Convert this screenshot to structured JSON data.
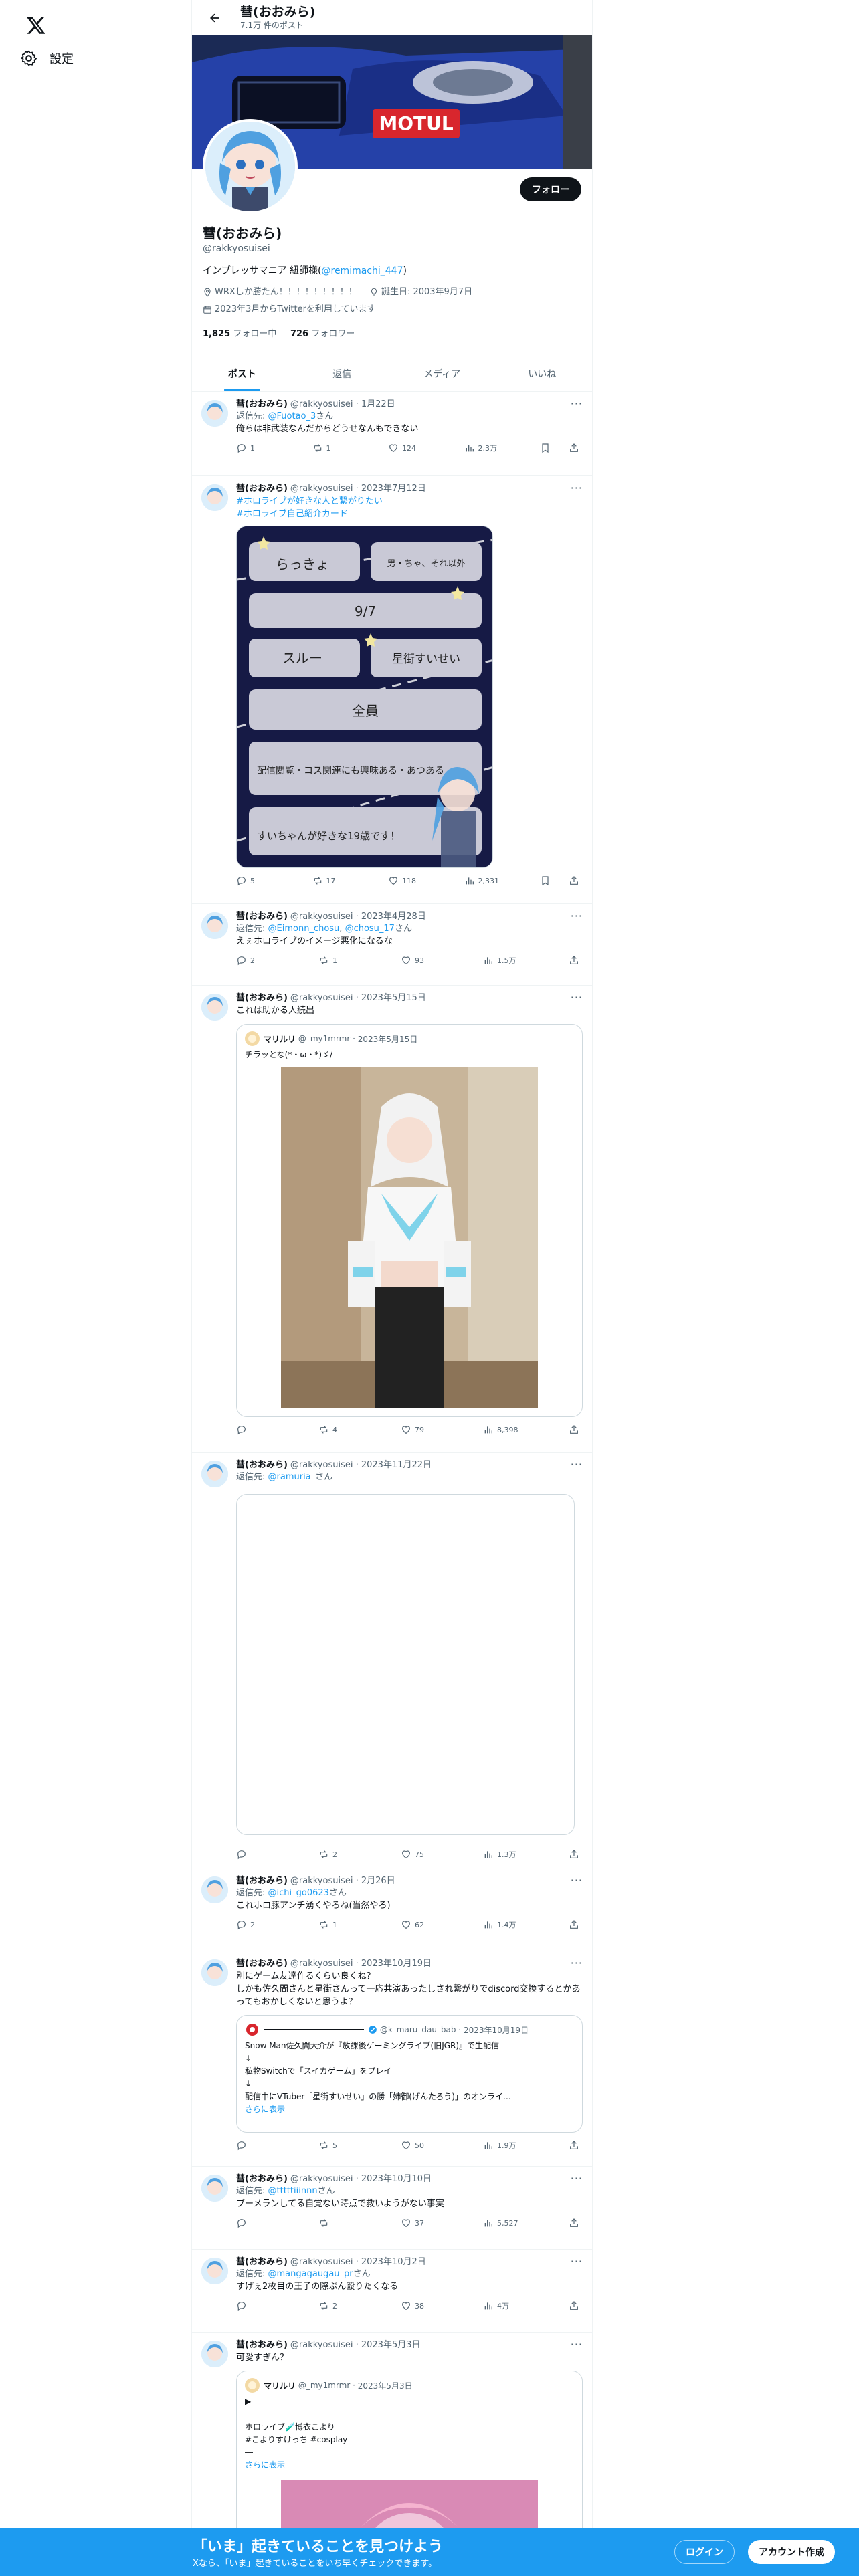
{
  "nav": {
    "settings_label": "設定"
  },
  "header": {
    "name": "彗(おおみら)",
    "post_count": "7.1万 件のポスト"
  },
  "banner": {
    "brand_text": "MOTUL"
  },
  "profile": {
    "follow_label": "フォロー",
    "name": "彗(おおみら)",
    "handle": "@rakkyosuisei",
    "bio_text": "インプレッサマニア 紐師様(",
    "bio_link": "@remimachi_447",
    "bio_end": ")",
    "location": "WRXしか勝たん！！！！！！！！！",
    "birthday": "誕生日: 2003年9月7日",
    "joined": "2023年3月からTwitterを利用しています",
    "following_count": "1,825",
    "following_label": "フォロー中",
    "followers_count": "726",
    "followers_label": "フォロワー"
  },
  "tabs": [
    "ポスト",
    "返信",
    "メディア",
    "いいね"
  ],
  "tweets": [
    {
      "name": "彗(おおみら)",
      "handle": "@rakkyosuisei",
      "date": "1月22日",
      "reply_prefix": "返信先: ",
      "reply_to": "@Fuotao_3",
      "reply_suffix": "さん",
      "text": "俺らは非武装なんだからどうせなんもできない",
      "replies": "1",
      "reposts": "1",
      "likes": "124",
      "views": "2.3万"
    },
    {
      "name": "彗(おおみら)",
      "handle": "@rakkyosuisei",
      "date": "2023年7月12日",
      "hashtag1": "#ホロライブが好きな人と繋がりたい",
      "hashtag2": "#ホロライブ自己紹介カード",
      "replies": "5",
      "reposts": "17",
      "likes": "118",
      "views": "2,331",
      "card": {
        "field1": "らっきょ",
        "field2": "男・ちゃ、それ以外",
        "field3": "9/7",
        "field4": "スルー",
        "field5": "星街すいせい",
        "field6": "全員",
        "field7": "配信閲覧・コス関連にも興味ある・あつある",
        "field8": "すいちゃんが好きな19歳です！"
      }
    },
    {
      "name": "彗(おおみら)",
      "handle": "@rakkyosuisei",
      "date": "2023年4月28日",
      "reply_prefix": "返信先: ",
      "reply_to": "@Eimonn_chosu",
      "reply_to2": "@chosu_17",
      "reply_suffix": "さん",
      "text": "えぇホロライブのイメージ悪化になるな",
      "replies": "2",
      "reposts": "1",
      "likes": "93",
      "views": "1.5万"
    },
    {
      "name": "彗(おおみら)",
      "handle": "@rakkyosuisei",
      "date": "2023年5月15日",
      "text": "これは助かる人続出",
      "quote": {
        "name": "マリルリ",
        "handle": "@_my1mrmr",
        "date": "2023年5月15日",
        "text": "チラッとな(*・ω・*)ゞ/"
      },
      "replies": "",
      "reposts": "4",
      "likes": "79",
      "views": "8,398"
    },
    {
      "name": "彗(おおみら)",
      "handle": "@rakkyosuisei",
      "date": "2023年11月22日",
      "reply_prefix": "返信先: ",
      "reply_to": "@ramuria_",
      "reply_suffix": "さん",
      "replies": "",
      "reposts": "2",
      "likes": "75",
      "views": "1.3万"
    },
    {
      "name": "彗(おおみら)",
      "handle": "@rakkyosuisei",
      "date": "2月26日",
      "reply_prefix": "返信先: ",
      "reply_to": "@ichi_go0623",
      "reply_suffix": "さん",
      "text": "これホロ豚アンチ湧くやろね(当然やろ)",
      "replies": "2",
      "reposts": "1",
      "likes": "62",
      "views": "1.4万"
    },
    {
      "name": "彗(おおみら)",
      "handle": "@rakkyosuisei",
      "date": "2023年10月19日",
      "text": "別にゲーム友達作るくらい良くね？\nしかも佐久間さんと星街さんって一応共演あったしされ繋がりでdiscord交換するとかあってもおかしくないと思うよ？",
      "quote": {
        "name": "",
        "handle": "@k_maru_dau_bab",
        "date": "2023年10月19日",
        "text": "Snow Man佐久間大介が『放課後ゲーミングライブ(旧JGR)』で生配信\n↓\n私物Switchで「スイカゲーム」をプレイ\n↓\n配信中にVTuber「星街すいせい」の勝「姉御(げんたろう)」のオンライ…",
        "more": "さらに表示"
      },
      "replies": "",
      "reposts": "5",
      "likes": "50",
      "views": "1.9万"
    },
    {
      "name": "彗(おおみら)",
      "handle": "@rakkyosuisei",
      "date": "2023年10月10日",
      "reply_prefix": "返信先: ",
      "reply_to": "@tttttiiinnn",
      "reply_suffix": "さん",
      "text": "ブーメランしてる自覚ない時点で救いようがない事実",
      "replies": "",
      "reposts": "",
      "likes": "37",
      "views": "5,527"
    },
    {
      "name": "彗(おおみら)",
      "handle": "@rakkyosuisei",
      "date": "2023年10月2日",
      "reply_prefix": "返信先: ",
      "reply_to": "@mangagaugau_pr",
      "reply_suffix": "さん",
      "text": "すげぇ2枚目の王子の際ぷん殴りたくなる",
      "replies": "",
      "reposts": "2",
      "likes": "38",
      "views": "4万"
    },
    {
      "name": "彗(おおみら)",
      "handle": "@rakkyosuisei",
      "date": "2023年5月3日",
      "text": "可愛すぎん？",
      "quote": {
        "name": "マリルリ",
        "handle": "@_my1mrmr",
        "date": "2023年5月3日",
        "text": "▶\n\nホロライブ🧪博衣こより\n#こよりすけっち #cosplay\n―",
        "more": "さらに表示"
      }
    }
  ],
  "bottom": {
    "title": "「いま」起きていることを見つけよう",
    "subtitle": "Xなら、「いま」起きていることをいち早くチェックできます。",
    "login": "ログイン",
    "signup": "アカウント作成"
  },
  "colors": {
    "accent": "#1d9bf0",
    "text": "#0f1419",
    "muted": "#536471"
  }
}
